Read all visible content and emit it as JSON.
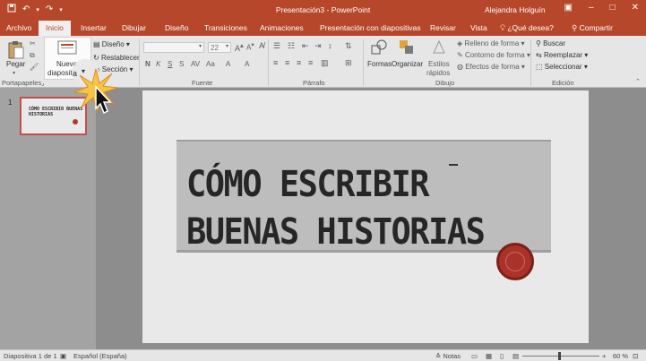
{
  "title_bar": {
    "document_title": "Presentación3 - PowerPoint",
    "user_name": "Alejandra Holguín",
    "qat_icons": [
      "save-icon",
      "undo-icon",
      "redo-icon",
      "customize-icon"
    ],
    "window_controls": [
      "restore-ribbon-icon",
      "minimize-icon",
      "maximize-icon",
      "close-icon"
    ]
  },
  "tabs": [
    {
      "label": "Archivo"
    },
    {
      "label": "Inicio",
      "active": true
    },
    {
      "label": "Insertar"
    },
    {
      "label": "Dibujar"
    },
    {
      "label": "Diseño"
    },
    {
      "label": "Transiciones"
    },
    {
      "label": "Animaciones"
    },
    {
      "label": "Presentación con diapositivas"
    },
    {
      "label": "Revisar"
    },
    {
      "label": "Vista"
    }
  ],
  "tell_me": "¿Qué desea?",
  "share": "Compartir",
  "ribbon": {
    "clipboard": {
      "paste_label": "Pegar",
      "group_label": "Portapapeles"
    },
    "slides": {
      "new_slide_label_1": "Nueva",
      "new_slide_label_2": "diapositiv",
      "new_slide_partial": "a",
      "layout_label": "Diseño",
      "reset_label": "Restablecer",
      "section_label": "Sección"
    },
    "font": {
      "size_value": "22",
      "group_label": "Fuente",
      "format_buttons": [
        "N",
        "K",
        "S",
        "S",
        "AV",
        "Aa",
        "A",
        "A"
      ]
    },
    "paragraph": {
      "group_label": "Párrafo"
    },
    "drawing": {
      "shapes_label": "Formas",
      "arrange_label": "Organizar",
      "styles_label_1": "Estilos",
      "styles_label_2": "rápidos",
      "fill_label": "Relleno de forma",
      "outline_label": "Contorno de forma",
      "effects_label": "Efectos de forma",
      "group_label": "Dibujo"
    },
    "editing": {
      "find_label": "Buscar",
      "replace_label": "Reemplazar",
      "select_label": "Seleccionar",
      "group_label": "Edición"
    }
  },
  "thumbnails": [
    {
      "number": "1",
      "title": "CÓMO ESCRIBIR BUENAS HISTORIAS"
    }
  ],
  "slide": {
    "title": "CÓMO ESCRIBIR\nBUENAS HISTORIAS"
  },
  "status_bar": {
    "slide_info": "Diapositiva 1 de 1",
    "language": "Español (España)",
    "notes_label": "Notas",
    "zoom": "60 %"
  },
  "colors": {
    "accent": "#b7472a",
    "seal": "#a8332a"
  }
}
